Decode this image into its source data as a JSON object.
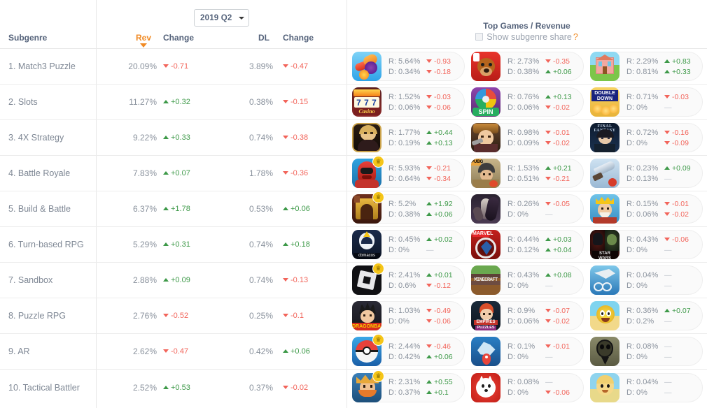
{
  "header": {
    "period_label": "2019 Q2",
    "col_subgenre": "Subgenre",
    "col_rev": "Rev",
    "col_change_rev": "Change",
    "col_dl": "DL",
    "col_change_dl": "Change",
    "top_games_title": "Top Games / Revenue",
    "subgenre_share_label": "Show subgenre share",
    "subgenre_share_help": "?",
    "sort_direction": "desc",
    "sort_column": "Rev",
    "subgenre_share_checked": false
  },
  "colors": {
    "accent": "#f08a24",
    "positive": "#3d9948",
    "negative": "#f2645a",
    "neutral": "#c0c5cc",
    "header_text": "#54627a",
    "body_text": "#8a929d"
  },
  "rows": [
    {
      "name": "1. Match3 Puzzle",
      "rev": "20.09%",
      "rev_change": "-0.71",
      "rev_dir": "down",
      "dl": "3.89%",
      "dl_change": "-0.47",
      "dl_dir": "down",
      "games": [
        {
          "icon": "candy-crush-saga",
          "crown": false,
          "r": "R: 5.64%",
          "r_delta": "-0.93",
          "r_dir": "down",
          "d": "D: 0.34%",
          "d_delta": "-0.18",
          "d_dir": "down"
        },
        {
          "icon": "toon-blast",
          "crown": false,
          "r": "R: 2.73%",
          "r_delta": "-0.35",
          "r_dir": "down",
          "d": "D: 0.38%",
          "d_delta": "+0.06",
          "d_dir": "up"
        },
        {
          "icon": "homescapes",
          "crown": false,
          "r": "R: 2.29%",
          "r_delta": "+0.83",
          "r_dir": "up",
          "d": "D: 0.81%",
          "d_delta": "+0.33",
          "d_dir": "up"
        }
      ]
    },
    {
      "name": "2. Slots",
      "rev": "11.27%",
      "rev_change": "+0.32",
      "rev_dir": "up",
      "dl": "0.38%",
      "dl_change": "-0.15",
      "dl_dir": "down",
      "games": [
        {
          "icon": "slotomania-777-casino",
          "crown": false,
          "r": "R: 1.52%",
          "r_delta": "-0.03",
          "r_dir": "down",
          "d": "D: 0.06%",
          "d_delta": "-0.06",
          "d_dir": "down"
        },
        {
          "icon": "spin-wheel-slots",
          "crown": false,
          "r": "R: 0.76%",
          "r_delta": "+0.13",
          "r_dir": "up",
          "d": "D: 0.06%",
          "d_delta": "-0.02",
          "d_dir": "down"
        },
        {
          "icon": "doubledown-casino",
          "crown": false,
          "r": "R: 0.71%",
          "r_delta": "-0.03",
          "r_dir": "down",
          "d": "D: 0%",
          "d_delta": "—",
          "d_dir": "flat"
        }
      ]
    },
    {
      "name": "3. 4X Strategy",
      "rev": "9.22%",
      "rev_change": "+0.33",
      "rev_dir": "up",
      "dl": "0.74%",
      "dl_change": "-0.38",
      "dl_dir": "down",
      "games": [
        {
          "icon": "game-of-war-portrait",
          "crown": false,
          "r": "R: 1.77%",
          "r_delta": "+0.44",
          "r_dir": "up",
          "d": "D: 0.19%",
          "d_delta": "+0.13",
          "d_dir": "up"
        },
        {
          "icon": "guns-of-glory",
          "crown": false,
          "r": "R: 0.98%",
          "r_delta": "-0.01",
          "r_dir": "down",
          "d": "D: 0.09%",
          "d_delta": "-0.02",
          "d_dir": "down"
        },
        {
          "icon": "final-fantasy-xv",
          "crown": false,
          "r": "R: 0.72%",
          "r_delta": "-0.16",
          "r_dir": "down",
          "d": "D: 0%",
          "d_delta": "-0.09",
          "d_dir": "down"
        }
      ]
    },
    {
      "name": "4. Battle Royale",
      "rev": "7.83%",
      "rev_change": "+0.07",
      "rev_dir": "up",
      "dl": "1.78%",
      "dl_change": "-0.36",
      "dl_dir": "down",
      "games": [
        {
          "icon": "fortnite-red-helmet",
          "crown": true,
          "r": "R: 5.93%",
          "r_delta": "-0.21",
          "r_dir": "down",
          "d": "D: 0.64%",
          "d_delta": "-0.34",
          "d_dir": "down"
        },
        {
          "icon": "pubg-mobile",
          "crown": false,
          "r": "R: 1.53%",
          "r_delta": "+0.21",
          "r_dir": "up",
          "d": "D: 0.51%",
          "d_delta": "-0.21",
          "d_dir": "down"
        },
        {
          "icon": "knives-out",
          "crown": false,
          "r": "R: 0.23%",
          "r_delta": "+0.09",
          "r_dir": "up",
          "d": "D: 0.13%",
          "d_delta": "—",
          "d_dir": "flat"
        }
      ]
    },
    {
      "name": "5. Build & Battle",
      "rev": "6.37%",
      "rev_change": "+1.78",
      "rev_dir": "up",
      "dl": "0.53%",
      "dl_change": "+0.06",
      "dl_dir": "up",
      "games": [
        {
          "icon": "lords-mobile-gate",
          "crown": true,
          "r": "R: 5.2%",
          "r_delta": "+1.92",
          "r_dir": "up",
          "d": "D: 0.38%",
          "d_delta": "+0.06",
          "d_dir": "up"
        },
        {
          "icon": "dark-fantasy-strategy",
          "crown": false,
          "r": "R: 0.26%",
          "r_delta": "-0.05",
          "r_dir": "down",
          "d": "D: 0%",
          "d_delta": "—",
          "d_dir": "flat"
        },
        {
          "icon": "hustle-castle-king",
          "crown": false,
          "r": "R: 0.15%",
          "r_delta": "-0.01",
          "r_dir": "down",
          "d": "D: 0.06%",
          "d_delta": "-0.02",
          "d_dir": "down"
        }
      ]
    },
    {
      "name": "6. Turn-based RPG",
      "rev": "5.29%",
      "rev_change": "+0.31",
      "rev_dir": "up",
      "dl": "0.74%",
      "dl_change": "+0.18",
      "dl_dir": "up",
      "games": [
        {
          "icon": "cbmacos-rpg",
          "crown": false,
          "r": "R: 0.45%",
          "r_delta": "+0.02",
          "r_dir": "up",
          "d": "D: 0%",
          "d_delta": "—",
          "d_dir": "flat"
        },
        {
          "icon": "marvel-strike-force",
          "crown": false,
          "r": "R: 0.44%",
          "r_delta": "+0.03",
          "r_dir": "up",
          "d": "D: 0.12%",
          "d_delta": "+0.04",
          "d_dir": "up"
        },
        {
          "icon": "star-wars-galaxy-of-heroes",
          "crown": false,
          "r": "R: 0.43%",
          "r_delta": "-0.06",
          "r_dir": "down",
          "d": "D: 0%",
          "d_delta": "—",
          "d_dir": "flat"
        }
      ]
    },
    {
      "name": "7. Sandbox",
      "rev": "2.88%",
      "rev_change": "+0.09",
      "rev_dir": "up",
      "dl": "0.74%",
      "dl_change": "-0.13",
      "dl_dir": "down",
      "games": [
        {
          "icon": "roblox",
          "crown": true,
          "r": "R: 2.41%",
          "r_delta": "+0.01",
          "r_dir": "up",
          "d": "D: 0.6%",
          "d_delta": "-0.12",
          "d_dir": "down"
        },
        {
          "icon": "minecraft",
          "crown": false,
          "r": "R: 0.43%",
          "r_delta": "+0.08",
          "r_dir": "up",
          "d": "D: 0%",
          "d_delta": "—",
          "d_dir": "flat"
        },
        {
          "icon": "infinite-flight",
          "crown": false,
          "r": "R: 0.04%",
          "r_delta": "—",
          "r_dir": "flat",
          "d": "D: 0%",
          "d_delta": "—",
          "d_dir": "flat"
        }
      ]
    },
    {
      "name": "8. Puzzle RPG",
      "rev": "2.76%",
      "rev_change": "-0.52",
      "rev_dir": "down",
      "dl": "0.25%",
      "dl_change": "-0.1",
      "dl_dir": "down",
      "games": [
        {
          "icon": "dragon-ball-z-dokkan",
          "crown": false,
          "r": "R: 1.03%",
          "r_delta": "-0.49",
          "r_dir": "down",
          "d": "D: 0%",
          "d_delta": "-0.06",
          "d_dir": "down"
        },
        {
          "icon": "empires-and-puzzles",
          "crown": false,
          "r": "R: 0.9%",
          "r_delta": "-0.07",
          "r_dir": "down",
          "d": "D: 0.06%",
          "d_delta": "-0.02",
          "d_dir": "down"
        },
        {
          "icon": "best-fiends",
          "crown": false,
          "r": "R: 0.36%",
          "r_delta": "+0.07",
          "r_dir": "up",
          "d": "D: 0.2%",
          "d_delta": "—",
          "d_dir": "flat"
        }
      ]
    },
    {
      "name": "9. AR",
      "rev": "2.62%",
      "rev_change": "-0.47",
      "rev_dir": "down",
      "dl": "0.42%",
      "dl_change": "+0.06",
      "dl_dir": "up",
      "games": [
        {
          "icon": "pokemon-go",
          "crown": true,
          "r": "R: 2.44%",
          "r_delta": "-0.46",
          "r_dir": "down",
          "d": "D: 0.42%",
          "d_delta": "+0.06",
          "d_dir": "up"
        },
        {
          "icon": "jurassic-world-alive",
          "crown": false,
          "r": "R: 0.1%",
          "r_delta": "-0.01",
          "r_dir": "down",
          "d": "D: 0%",
          "d_delta": "—",
          "d_dir": "flat"
        },
        {
          "icon": "the-walking-dead-our-world",
          "crown": false,
          "r": "R: 0.08%",
          "r_delta": "—",
          "r_dir": "flat",
          "d": "D: 0%",
          "d_delta": "—",
          "d_dir": "flat"
        }
      ]
    },
    {
      "name": "10. Tactical Battler",
      "rev": "2.52%",
      "rev_change": "+0.53",
      "rev_dir": "up",
      "dl": "0.37%",
      "dl_change": "-0.02",
      "dl_dir": "down",
      "games": [
        {
          "icon": "clash-royale",
          "crown": true,
          "r": "R: 2.31%",
          "r_delta": "+0.55",
          "r_dir": "up",
          "d": "D: 0.37%",
          "d_delta": "+0.1",
          "d_dir": "up"
        },
        {
          "icon": "battle-cats",
          "crown": false,
          "r": "R: 0.08%",
          "r_delta": "—",
          "r_dir": "flat",
          "d": "D: 0%",
          "d_delta": "-0.06",
          "d_dir": "down"
        },
        {
          "icon": "south-park-phone-destroyer",
          "crown": false,
          "r": "R: 0.04%",
          "r_delta": "—",
          "r_dir": "flat",
          "d": "D: 0%",
          "d_delta": "—",
          "d_dir": "flat"
        }
      ]
    }
  ]
}
